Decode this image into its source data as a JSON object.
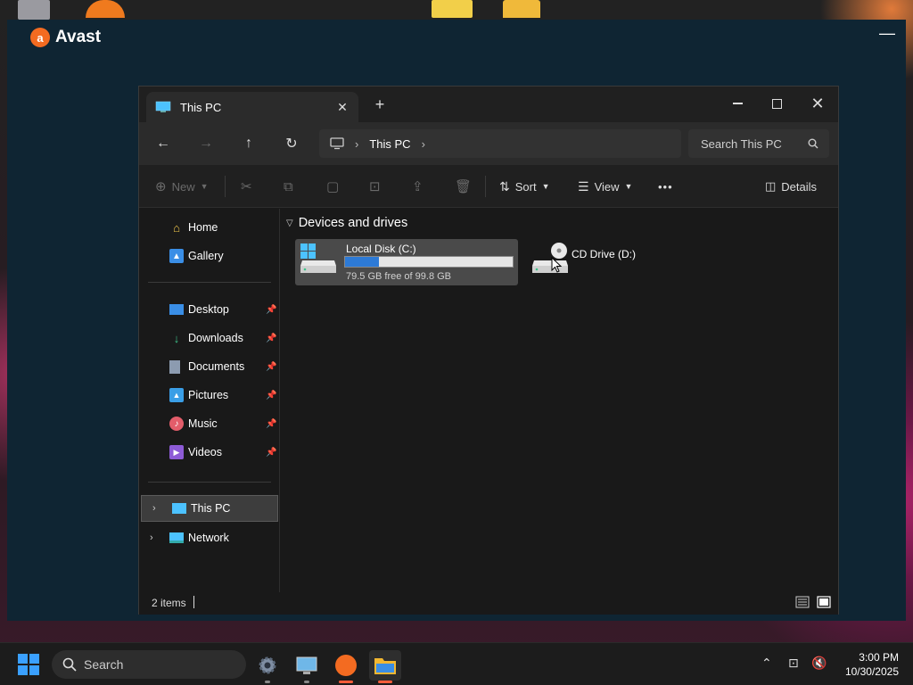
{
  "avast": {
    "title": "Avast"
  },
  "explorer": {
    "tab": {
      "title": "This PC",
      "close": "✕"
    },
    "new_tab": "+",
    "address": {
      "location": "This PC"
    },
    "search": {
      "placeholder": "Search This PC"
    },
    "toolbar": {
      "new_label": "New",
      "sort_label": "Sort",
      "view_label": "View",
      "more_label": "•••",
      "details_label": "Details"
    },
    "sidebar": {
      "top": [
        {
          "label": "Home",
          "icon": "home-icon"
        },
        {
          "label": "Gallery",
          "icon": "gallery-icon"
        }
      ],
      "pinned": [
        {
          "label": "Desktop",
          "icon": "desktop-folder-icon"
        },
        {
          "label": "Downloads",
          "icon": "downloads-icon"
        },
        {
          "label": "Documents",
          "icon": "documents-icon"
        },
        {
          "label": "Pictures",
          "icon": "pictures-icon"
        },
        {
          "label": "Music",
          "icon": "music-icon"
        },
        {
          "label": "Videos",
          "icon": "videos-icon"
        }
      ],
      "bottom": [
        {
          "label": "This PC",
          "icon": "this-pc-icon",
          "selected": true
        },
        {
          "label": "Network",
          "icon": "network-icon"
        }
      ]
    },
    "content": {
      "section_title": "Devices and drives",
      "drives": [
        {
          "name": "Local Disk (C:)",
          "free_text": "79.5 GB free of 99.8 GB",
          "used_fraction": 0.2
        },
        {
          "name": "CD Drive (D:)"
        }
      ]
    },
    "status": {
      "item_count": "2 items"
    }
  },
  "taskbar": {
    "search_label": "Search",
    "time": "3:00 PM",
    "date": "10/30/2025"
  },
  "colors": {
    "accent": "#2d7ad6",
    "avast_orange": "#f36b21",
    "windows_blue": "#3aa0ff"
  }
}
